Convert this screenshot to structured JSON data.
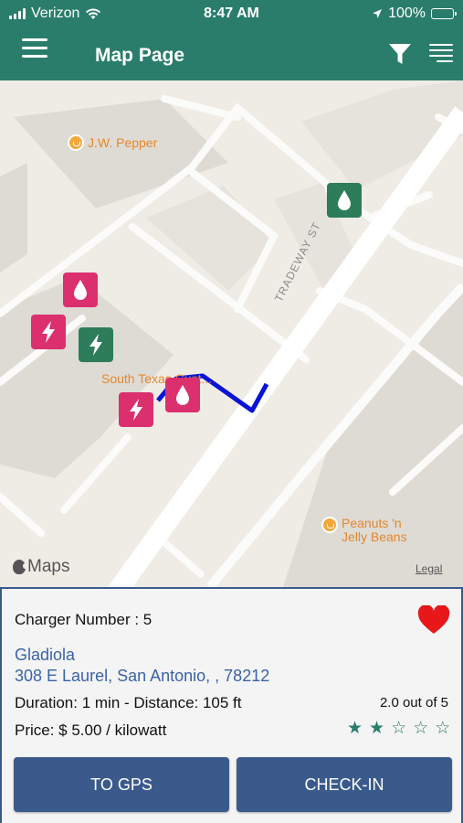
{
  "status_bar": {
    "carrier": "Verizon",
    "time": "8:47 AM",
    "battery": "100%",
    "battery_level": 1.0
  },
  "app_bar": {
    "title": "Map Page",
    "menu_icon": "hamburger-menu-icon",
    "filter_icon": "filter-funnel-icon",
    "list_icon": "list-icon"
  },
  "map": {
    "pois": [
      {
        "label": "J.W. Pepper"
      },
      {
        "label": "South Texas Cust..."
      },
      {
        "label_line1": "Peanuts 'n",
        "label_line2": "Jelly Beans"
      }
    ],
    "street": "TRADEWAY ST",
    "attribution": "Maps",
    "legal": "Legal",
    "markers": [
      {
        "type": "water",
        "color": "#2d7c5a"
      },
      {
        "type": "water",
        "color": "#dc2f6e"
      },
      {
        "type": "charger",
        "color": "#dc2f6e"
      },
      {
        "type": "charger",
        "color": "#2d7c5a"
      },
      {
        "type": "charger",
        "color": "#dc2f6e"
      },
      {
        "type": "water",
        "color": "#dc2f6e"
      }
    ],
    "route_color": "#0a14d6"
  },
  "details": {
    "charger_number": "Charger Number : 5",
    "name": "Gladiola",
    "address": "308 E Laurel, San Antonio, , 78212",
    "duration_distance": "Duration: 1 min - Distance: 105 ft",
    "rating_text": "2.0 out of 5",
    "rating_value": 2,
    "rating_max": 5,
    "price": "Price: $ 5.00 / kilowatt",
    "favorite": true,
    "heart_color": "#e8171a"
  },
  "actions": {
    "gps_label": "TO GPS",
    "checkin_label": "CHECK-IN"
  },
  "colors": {
    "header": "#2a7d6b",
    "button": "#3a5a8c",
    "link": "#3a63a8",
    "star": "#2a7d6b"
  }
}
